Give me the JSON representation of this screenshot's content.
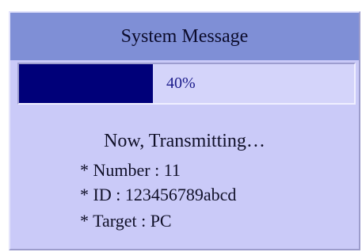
{
  "dialog": {
    "title": "System Message",
    "progress": {
      "value": 0.4,
      "label": "40%"
    },
    "status": "Now, Transmitting…",
    "details": [
      {
        "text": "* Number : 11"
      },
      {
        "text": "* ID : 123456789abcd"
      },
      {
        "text": "* Target : PC"
      }
    ]
  },
  "colors": {
    "title_bar": "#7f8fd6",
    "dialog_bg": "#cacaf8",
    "progress_fill": "#000079",
    "progress_track": "#d4d4fa"
  }
}
